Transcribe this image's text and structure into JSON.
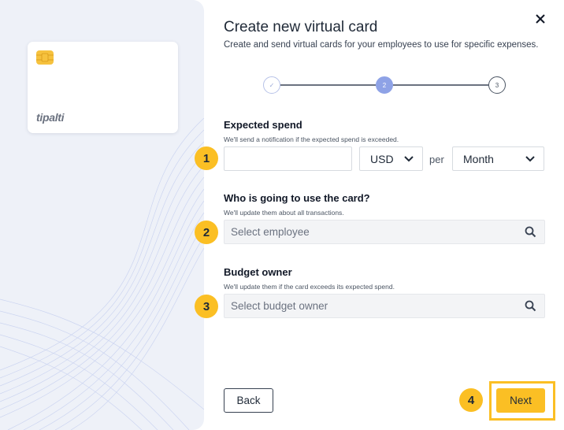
{
  "dialog": {
    "title": "Create new virtual card",
    "subtitle": "Create and send virtual cards for your employees to use for specific expenses.",
    "close_icon": "close-icon"
  },
  "card_preview": {
    "brand": "tipalti",
    "chip_icon": "chip-icon",
    "chip_color": "#f6c23e"
  },
  "stepper": {
    "current_step": 2,
    "steps": [
      {
        "label": "✓",
        "state": "done"
      },
      {
        "label": "2",
        "state": "active"
      },
      {
        "label": "3",
        "state": "upcoming"
      }
    ]
  },
  "expected_spend": {
    "label": "Expected spend",
    "hint": "We'll send a notification if the expected spend is exceeded.",
    "amount_value": "",
    "currency": "USD",
    "per_label": "per",
    "period": "Month"
  },
  "card_user": {
    "label": "Who is going to use the card?",
    "hint": "We'll update them about all transactions.",
    "placeholder": "Select employee"
  },
  "budget_owner": {
    "label": "Budget owner",
    "hint": "We'll update them if the card exceeds its expected spend.",
    "placeholder": "Select budget owner"
  },
  "annotations": [
    "1",
    "2",
    "3",
    "4"
  ],
  "footer": {
    "back_label": "Back",
    "next_label": "Next"
  },
  "colors": {
    "accent": "#fbbf24",
    "step_active": "#8ea2e6",
    "panel_bg": "#eef1f8"
  }
}
